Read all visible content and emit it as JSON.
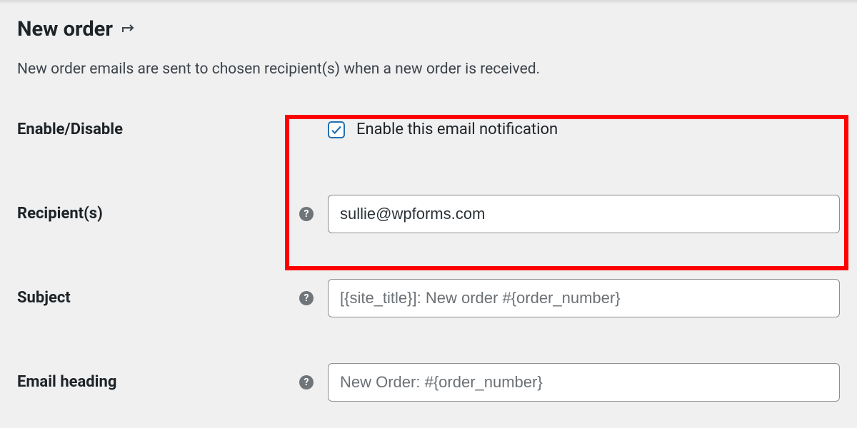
{
  "header": {
    "title": "New order",
    "description": "New order emails are sent to chosen recipient(s) when a new order is received."
  },
  "fields": {
    "enable": {
      "label": "Enable/Disable",
      "checkbox_label": "Enable this email notification",
      "checked": true
    },
    "recipients": {
      "label": "Recipient(s)",
      "value": "sullie@wpforms.com",
      "help": "?"
    },
    "subject": {
      "label": "Subject",
      "placeholder": "[{site_title}]: New order #{order_number}",
      "value": "",
      "help": "?"
    },
    "email_heading": {
      "label": "Email heading",
      "placeholder": "New Order: #{order_number}",
      "value": "",
      "help": "?"
    }
  }
}
